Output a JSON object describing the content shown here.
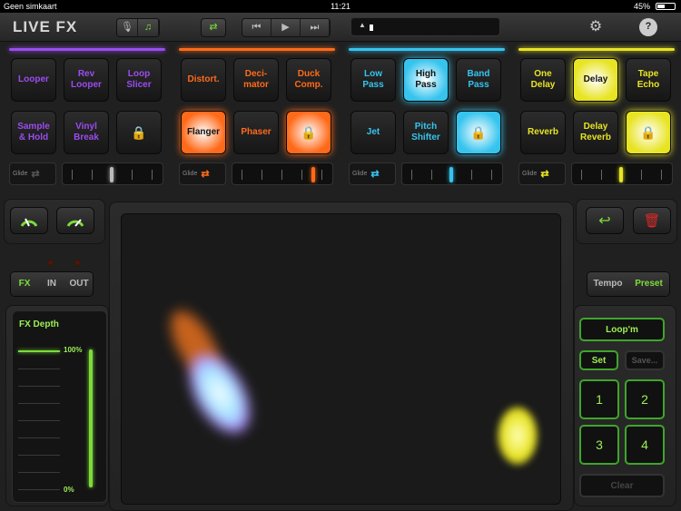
{
  "status": {
    "carrier": "Geen simkaart",
    "time": "11:21",
    "battery": "45%"
  },
  "app": {
    "title": "LIVE FX"
  },
  "toolbar": {
    "rewind": "⏮",
    "play": "▶",
    "forward": "⏭"
  },
  "sections": [
    {
      "color": "#9b4cf0",
      "pads": [
        "Looper",
        "Rev\nLooper",
        "Loop\nSlicer",
        "Sample\n& Hold",
        "Vinyl\nBreak",
        "🔒"
      ],
      "glide": "Glide",
      "active": []
    },
    {
      "color": "#ff6a1a",
      "pads": [
        "Distort.",
        "Deci-\nmator",
        "Duck\nComp.",
        "Flanger",
        "Phaser",
        "🔒"
      ],
      "glide": "Glide",
      "active": [
        3,
        5
      ]
    },
    {
      "color": "#36c4ee",
      "pads": [
        "Low\nPass",
        "High\nPass",
        "Band\nPass",
        "Jet",
        "Pitch\nShifter",
        "🔒"
      ],
      "glide": "Glide",
      "active": [
        1,
        5
      ]
    },
    {
      "color": "#e8e424",
      "pads": [
        "One\nDelay",
        "Delay",
        "Tape\nEcho",
        "Reverb",
        "Delay\nReverb",
        "🔒"
      ],
      "glide": "Glide",
      "active": [
        1,
        5
      ]
    }
  ],
  "routing": {
    "fx": "FX",
    "in": "IN",
    "out": "OUT"
  },
  "depth": {
    "title": "FX Depth",
    "max": "100%",
    "min": "0%",
    "level": 1.0
  },
  "modes": {
    "tempo": "Tempo",
    "preset": "Preset"
  },
  "loop": {
    "loopm": "Loop'm",
    "set": "Set",
    "save": "Save...",
    "slots": [
      "1",
      "2",
      "3",
      "4"
    ],
    "clear": "Clear"
  },
  "colors": {
    "green": "#7ddc3a",
    "purple": "#9b4cf0",
    "orange": "#ff6a1a",
    "cyan": "#36c4ee",
    "yellow": "#e8e424"
  }
}
